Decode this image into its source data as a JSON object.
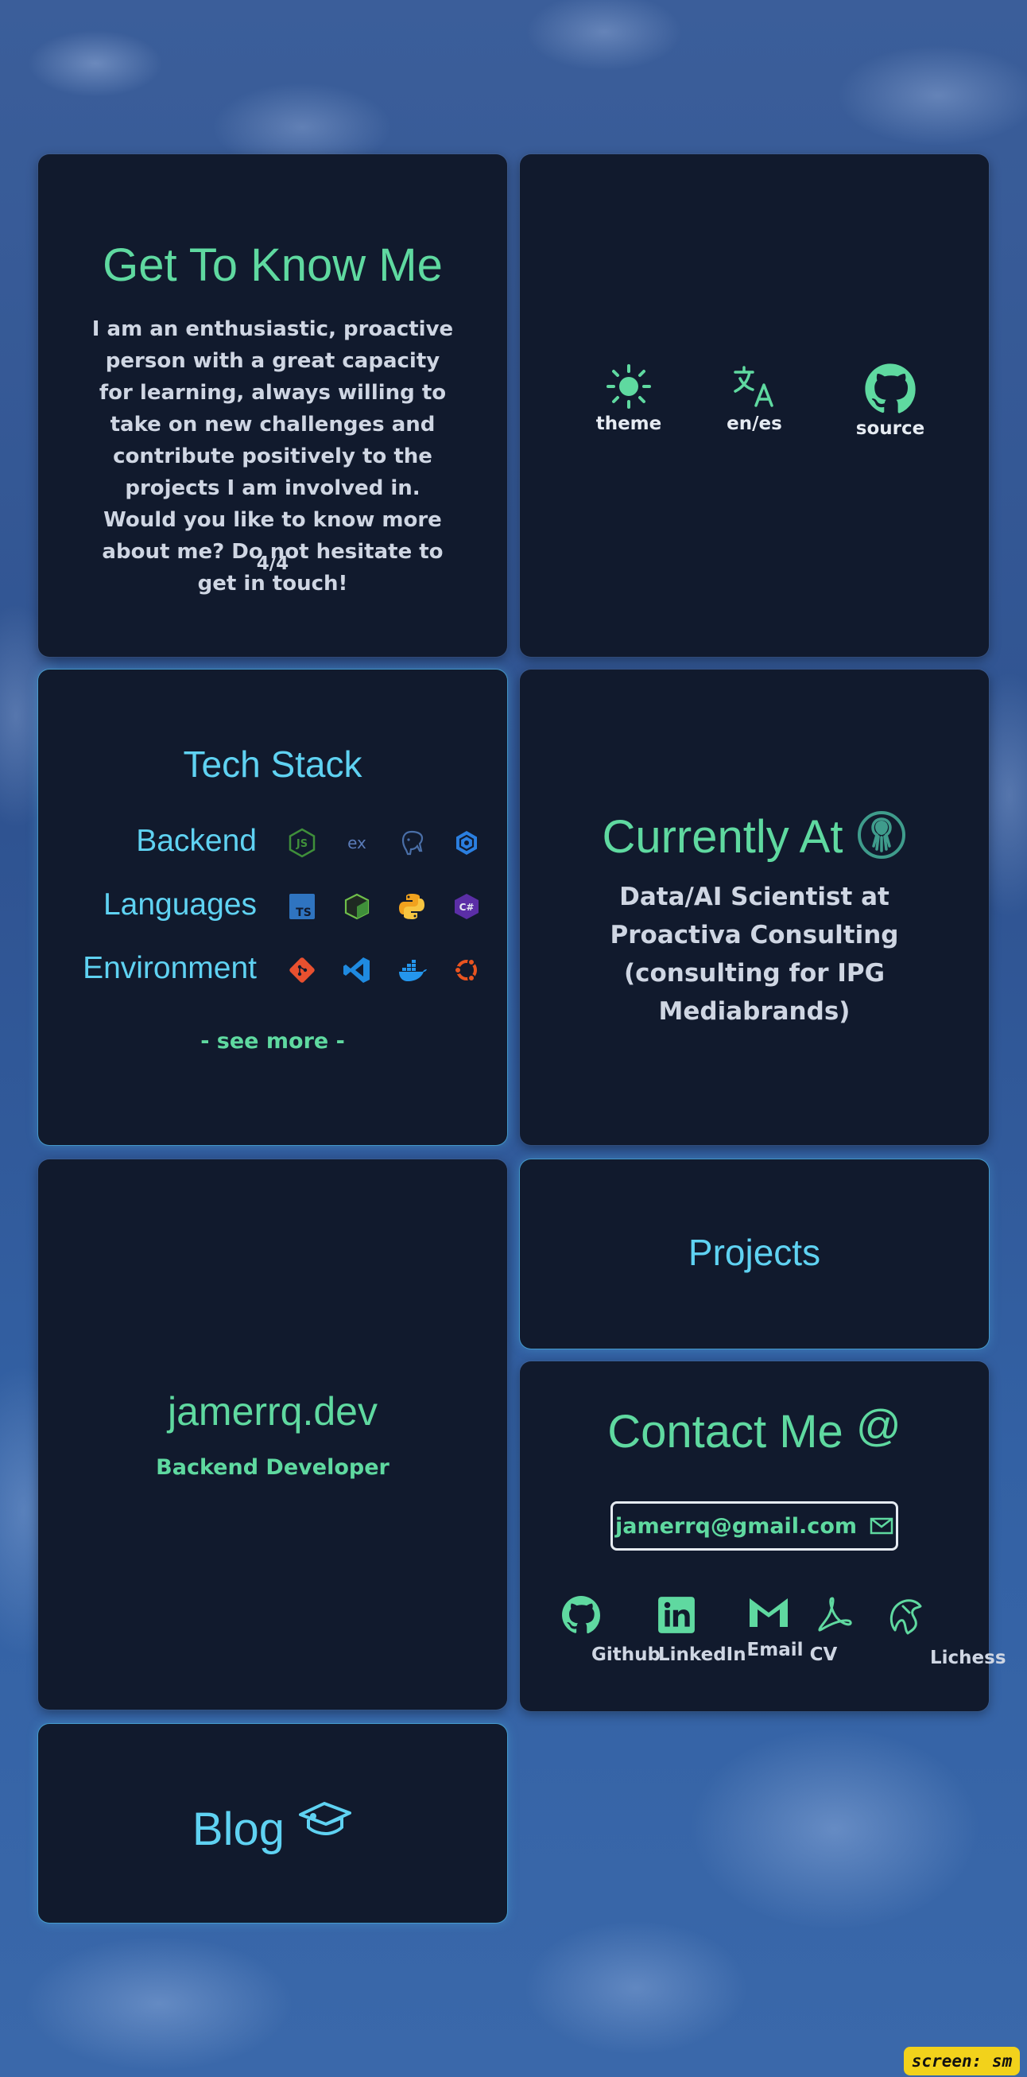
{
  "about": {
    "title": "Get To Know Me",
    "text": "I am an enthusiastic, proactive person with a great capacity for learning, always willing to take on new challenges and contribute positively to the projects I am involved in. Would you like to know more about me? Do not hesitate to get in touch!",
    "page": "4/4"
  },
  "controls": {
    "theme": {
      "label": "theme",
      "icon": "sun-icon"
    },
    "language": {
      "label": "en/es",
      "icon": "translate-icon"
    },
    "source": {
      "label": "source",
      "icon": "github-icon"
    }
  },
  "tech": {
    "title": "Tech Stack",
    "rows": [
      {
        "label": "Backend",
        "icons": [
          "nodejs-icon",
          "express-icon",
          "postgresql-icon",
          "graphql-icon"
        ]
      },
      {
        "label": "Languages",
        "icons": [
          "typescript-icon",
          "cube-icon",
          "python-icon",
          "csharp-icon"
        ]
      },
      {
        "label": "Environment",
        "icons": [
          "git-icon",
          "vscode-icon",
          "docker-icon",
          "ubuntu-icon"
        ]
      }
    ],
    "see_more": "- see more -"
  },
  "current": {
    "title": "Currently At",
    "text": "Data/AI Scientist at Proactiva Consulting (consulting for IPG Mediabrands)"
  },
  "identity": {
    "name": "jamerrq.dev",
    "role": "Backend Developer"
  },
  "projects": {
    "title": "Projects"
  },
  "contact": {
    "title": "Contact Me",
    "email": "jamerrq@gmail.com",
    "links": [
      {
        "label": "Github",
        "icon": "github-icon"
      },
      {
        "label": "LinkedIn",
        "icon": "linkedin-icon"
      },
      {
        "label": "Email",
        "icon": "gmail-icon"
      },
      {
        "label": "CV",
        "icon": "pdf-icon"
      },
      {
        "label": "Lichess",
        "icon": "lichess-icon"
      }
    ]
  },
  "blog": {
    "title": "Blog"
  },
  "badge": "screen: sm",
  "colors": {
    "accent_green": "#5fd9a0",
    "accent_cyan": "#5fd2f2",
    "card_bg": "#111a2d"
  }
}
